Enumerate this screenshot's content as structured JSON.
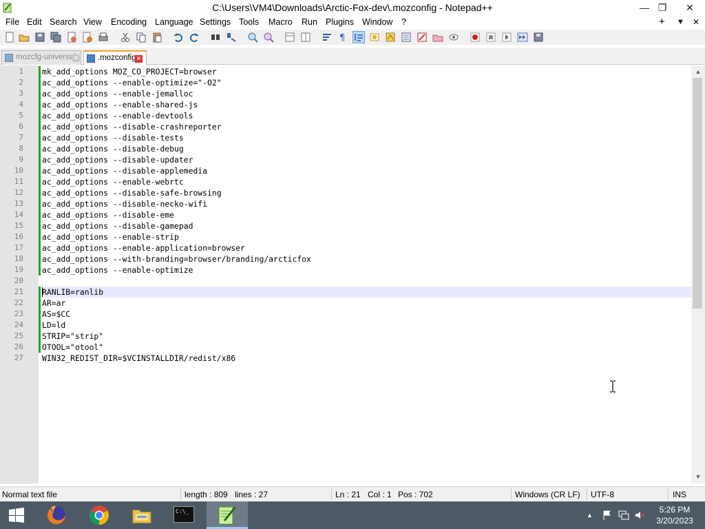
{
  "window": {
    "title": "C:\\Users\\VM4\\Downloads\\Arctic-Fox-dev\\.mozconfig - Notepad++",
    "min_glyph": "—",
    "restore_glyph": "❐",
    "close_glyph": "✕"
  },
  "menu": [
    "File",
    "Edit",
    "Search",
    "View",
    "Encoding",
    "Language",
    "Settings",
    "Tools",
    "Macro",
    "Run",
    "Plugins",
    "Window",
    "?"
  ],
  "menu_right": {
    "add": "+",
    "dropdown": "▼",
    "close": "✕"
  },
  "tabs": [
    {
      "label": "mozcfg-universal",
      "active": false
    },
    {
      "label": ".mozconfig",
      "active": true
    }
  ],
  "editor": {
    "lines": [
      "mk_add_options MOZ_CO_PROJECT=browser",
      "ac_add_options --enable-optimize=\"-O2\"",
      "ac_add_options --enable-jemalloc",
      "ac_add_options --enable-shared-js",
      "ac_add_options --enable-devtools",
      "ac_add_options --disable-crashreporter",
      "ac_add_options --disable-tests",
      "ac_add_options --disable-debug",
      "ac_add_options --disable-updater",
      "ac_add_options --disable-applemedia",
      "ac_add_options --enable-webrtc",
      "ac_add_options --disable-safe-browsing",
      "ac_add_options --disable-necko-wifi",
      "ac_add_options --disable-eme",
      "ac_add_options --disable-gamepad",
      "ac_add_options --enable-strip",
      "ac_add_options --enable-application=browser",
      "ac_add_options --with-branding=browser/branding/arcticfox",
      "ac_add_options --enable-optimize",
      "",
      "RANLIB=ranlib",
      "AR=ar",
      "AS=$CC",
      "LD=ld",
      "STRIP=\"strip\"",
      "OTOOL=\"otool\"",
      "WIN32_REDIST_DIR=$VCINSTALLDIR/redist/x86"
    ],
    "line_numbers": [
      "1",
      "2",
      "3",
      "4",
      "5",
      "6",
      "7",
      "8",
      "9",
      "10",
      "11",
      "12",
      "13",
      "14",
      "15",
      "16",
      "17",
      "18",
      "19",
      "20",
      "21",
      "22",
      "23",
      "24",
      "25",
      "26",
      "27"
    ],
    "current_line": 21
  },
  "status": {
    "file_type": "Normal text file",
    "length": "length : 809",
    "lines": "lines : 27",
    "ln": "Ln : 21",
    "col": "Col : 1",
    "pos": "Pos : 702",
    "eol": "Windows (CR LF)",
    "encoding": "UTF-8",
    "mode": "INS"
  },
  "taskbar": {
    "time": "5:26 PM",
    "date": "3/20/2023",
    "apps": [
      "start",
      "firefox",
      "chrome",
      "file-explorer",
      "command-prompt",
      "notepad-plus-plus"
    ],
    "cmd_label": "C:\\_"
  },
  "colors": {
    "change_marker": "#28a028",
    "current_line": "#e8e8ff",
    "taskbar": "#4d5a66"
  }
}
